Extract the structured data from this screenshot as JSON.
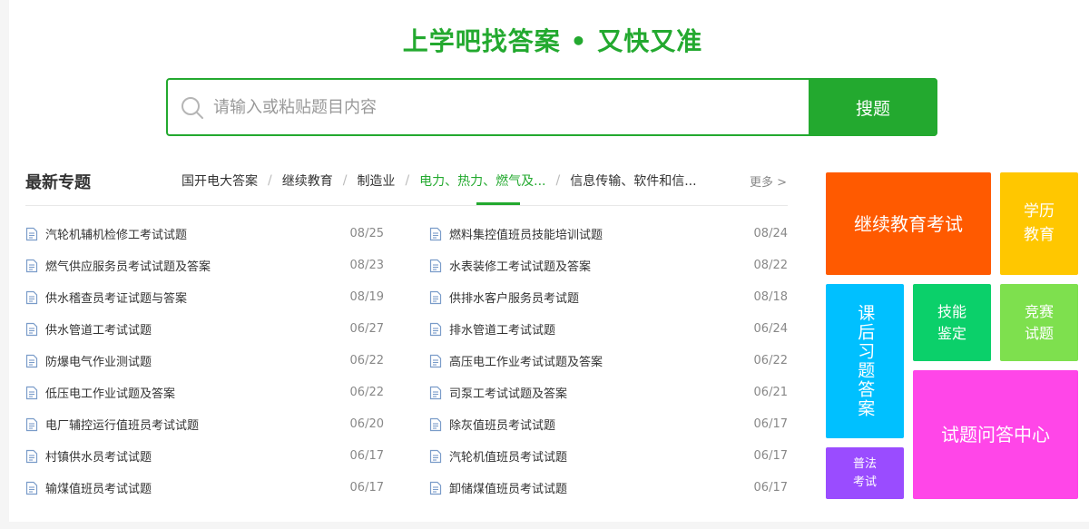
{
  "header": {
    "slogan": "上学吧找答案 • 又快又准"
  },
  "search": {
    "placeholder": "请输入或粘贴题目内容",
    "button_label": "搜题"
  },
  "topics": {
    "title": "最新专题",
    "tabs": [
      "国开电大答案",
      "继续教育",
      "制造业",
      "电力、热力、燃气及...",
      "信息传输、软件和信..."
    ],
    "active_tab_index": 3,
    "more": "更多 >"
  },
  "list_left": [
    {
      "title": "汽轮机辅机检修工考试试题",
      "date": "08/25"
    },
    {
      "title": "燃气供应服务员考试试题及答案",
      "date": "08/23"
    },
    {
      "title": "供水稽查员考证试题与答案",
      "date": "08/19"
    },
    {
      "title": "供水管道工考试试题",
      "date": "06/27"
    },
    {
      "title": "防爆电气作业测试题",
      "date": "06/22"
    },
    {
      "title": "低压电工作业试题及答案",
      "date": "06/22"
    },
    {
      "title": "电厂辅控运行值班员考试试题",
      "date": "06/20"
    },
    {
      "title": "村镇供水员考试试题",
      "date": "06/17"
    },
    {
      "title": "输煤值班员考试试题",
      "date": "06/17"
    }
  ],
  "list_right": [
    {
      "title": "燃料集控值班员技能培训试题",
      "date": "08/24"
    },
    {
      "title": "水表装修工考试试题及答案",
      "date": "08/22"
    },
    {
      "title": "供排水客户服务员考试题",
      "date": "08/18"
    },
    {
      "title": "排水管道工考试试题",
      "date": "06/24"
    },
    {
      "title": "高压电工作业考试试题及答案",
      "date": "06/22"
    },
    {
      "title": "司泵工考试试题及答案",
      "date": "06/21"
    },
    {
      "title": "除灰值班员考试试题",
      "date": "06/17"
    },
    {
      "title": "汽轮机值班员考试试题",
      "date": "06/17"
    },
    {
      "title": "卸储煤值班员考试试题",
      "date": "06/17"
    }
  ],
  "tiles": {
    "continuing_education": "继续教育考试",
    "academic_education": "学历教育",
    "homework_answers": "课后习题答案",
    "skill_appraisal": "技能鉴定",
    "competition_questions": "竞赛试题",
    "qa_center": "试题问答中心",
    "law_exam": "普法考试"
  },
  "colors": {
    "brand_green": "#23a92f",
    "tile_orange": "#ff5a00",
    "tile_yellow": "#ffc700",
    "tile_cyan": "#00c0ff",
    "tile_green": "#0bd06a",
    "tile_light_green": "#7ee04e",
    "tile_magenta": "#ff46e8",
    "tile_purple": "#9a4cff"
  },
  "icons": {
    "search": "search-icon",
    "document": "document-icon"
  }
}
